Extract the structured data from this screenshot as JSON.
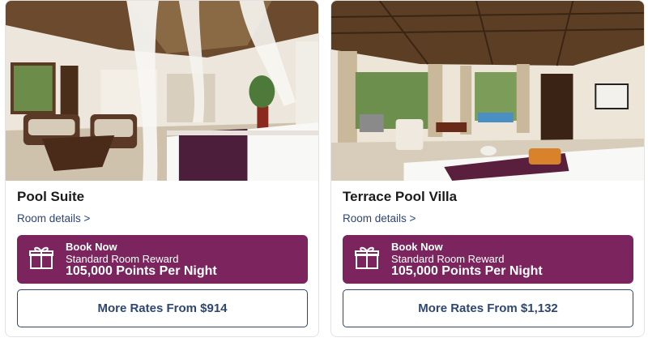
{
  "cards": [
    {
      "title": "Pool Suite",
      "details_link": "Room details >",
      "book": {
        "heading": "Book Now",
        "reward_type": "Standard Room Reward",
        "points": "105,000 Points Per Night",
        "icon": "gift-icon"
      },
      "rates_button": "More Rates From $914"
    },
    {
      "title": "Terrace Pool Villa",
      "details_link": "Room details >",
      "book": {
        "heading": "Book Now",
        "reward_type": "Standard Room Reward",
        "points": "105,000 Points Per Night",
        "icon": "gift-icon"
      },
      "rates_button": "More Rates From $1,132"
    }
  ],
  "colors": {
    "accent_purple": "#7b245e",
    "link_navy": "#2d4673"
  }
}
